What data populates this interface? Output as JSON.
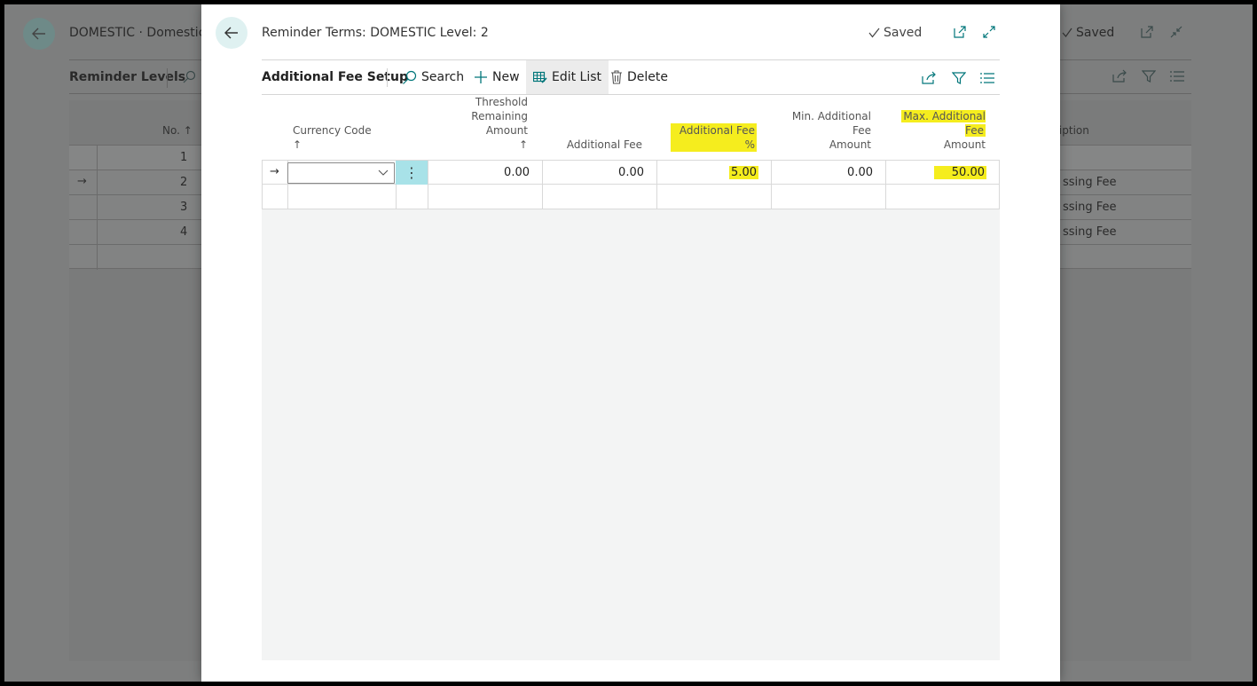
{
  "background": {
    "title": "DOMESTIC · Domestic C",
    "saved_label": "Saved",
    "toolbar_title": "Reminder Levels",
    "header_no": "No.",
    "header_desc": "ription",
    "rows": [
      {
        "num": "1",
        "desc": ""
      },
      {
        "num": "2",
        "desc": "ssing Fee"
      },
      {
        "num": "3",
        "desc": "ssing Fee"
      },
      {
        "num": "4",
        "desc": "ssing Fee"
      },
      {
        "num": "",
        "desc": ""
      }
    ]
  },
  "modal": {
    "title": "Reminder Terms: DOMESTIC Level: 2",
    "saved_label": "Saved",
    "toolbar": {
      "title": "Additional Fee Setup",
      "search_label": "Search",
      "new_label": "New",
      "edit_list_label": "Edit List",
      "delete_label": "Delete"
    },
    "columns": {
      "currency_code": "Currency Code",
      "threshold_line1": "Threshold",
      "threshold_line2": "Remaining Amount",
      "additional_fee": "Additional Fee",
      "additional_fee_pct": "Additional Fee %",
      "min_fee_line1": "Min. Additional Fee",
      "min_fee_line2": "Amount",
      "max_fee_line1": "Max. Additional Fee",
      "max_fee_line2": "Amount"
    },
    "rows": [
      {
        "currency_code": "",
        "threshold": "0.00",
        "additional_fee": "0.00",
        "additional_fee_pct": "5.00",
        "min_fee": "0.00",
        "max_fee": "50.00"
      }
    ]
  },
  "colors": {
    "accent": "#008489",
    "highlight": "#f5ed1e",
    "selected_cell": "#a8e2e8"
  }
}
